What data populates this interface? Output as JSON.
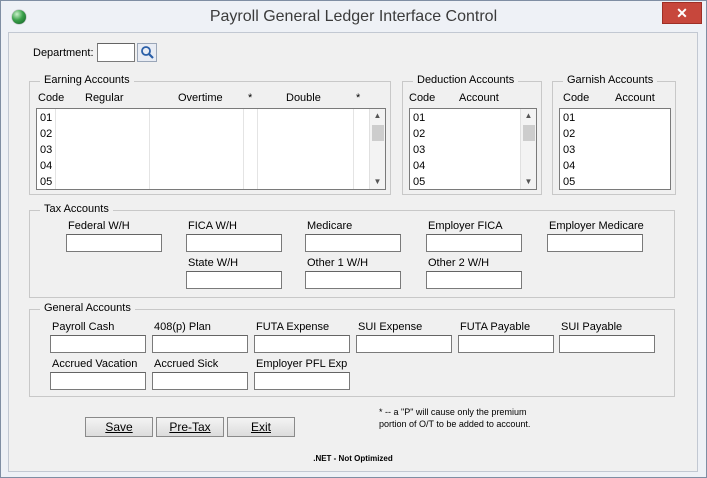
{
  "window": {
    "title": "Payroll  General Ledger Interface Control",
    "close_label": "✕"
  },
  "department": {
    "label": "Department:",
    "value": "",
    "lookup_icon": "magnifier-icon"
  },
  "earning": {
    "title": "Earning Accounts",
    "headers": {
      "code": "Code",
      "regular": "Regular",
      "overtime": "Overtime",
      "star1": "*",
      "double": "Double",
      "star2": "*"
    },
    "rows": [
      "01",
      "02",
      "03",
      "04",
      "05"
    ]
  },
  "deduction": {
    "title": "Deduction Accounts",
    "headers": {
      "code": "Code",
      "account": "Account"
    },
    "rows": [
      "01",
      "02",
      "03",
      "04",
      "05"
    ]
  },
  "garnish": {
    "title": "Garnish Accounts",
    "headers": {
      "code": "Code",
      "account": "Account"
    },
    "rows": [
      "01",
      "02",
      "03",
      "04",
      "05"
    ]
  },
  "tax": {
    "title": "Tax Accounts",
    "federal_wh": "Federal W/H",
    "fica_wh": "FICA W/H",
    "medicare": "Medicare",
    "employer_fica": "Employer FICA",
    "employer_medicare": "Employer Medicare",
    "state_wh": "State W/H",
    "other1_wh": "Other 1 W/H",
    "other2_wh": "Other 2 W/H"
  },
  "general": {
    "title": "General Accounts",
    "payroll_cash": "Payroll Cash",
    "plan_408p": "408(p) Plan",
    "futa_expense": "FUTA Expense",
    "sui_expense": "SUI Expense",
    "futa_payable": "FUTA Payable",
    "sui_payable": "SUI Payable",
    "accrued_vacation": "Accrued Vacation",
    "accrued_sick": "Accrued Sick",
    "employer_pfl_exp": "Employer PFL Exp"
  },
  "buttons": {
    "save": "Save",
    "pretax": "Pre-Tax",
    "exit": "Exit"
  },
  "note": {
    "line1": "* -- a \"P\" will cause only the premium",
    "line2": "portion of O/T to be added to account."
  },
  "footer": ".NET - Not Optimized",
  "colors": {
    "close": "#c7473c",
    "background": "#f0f0f0"
  }
}
